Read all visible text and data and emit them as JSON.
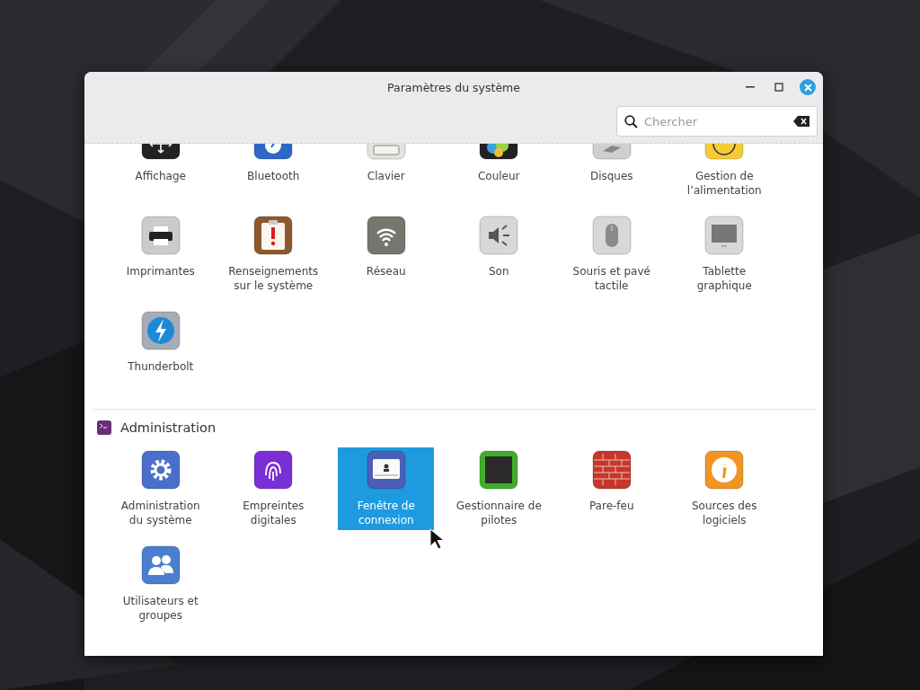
{
  "window": {
    "title": "Paramètres du système"
  },
  "search": {
    "placeholder": "Chercher"
  },
  "sections": [
    {
      "items": [
        {
          "label": "Affichage",
          "kind": "display",
          "selected": false,
          "clipped": true
        },
        {
          "label": "Bluetooth",
          "kind": "bluetooth",
          "selected": false,
          "clipped": true
        },
        {
          "label": "Clavier",
          "kind": "keyboard",
          "selected": false,
          "clipped": true
        },
        {
          "label": "Couleur",
          "kind": "color",
          "selected": false,
          "clipped": true
        },
        {
          "label": "Disques",
          "kind": "disks",
          "selected": false,
          "clipped": true
        },
        {
          "label": "Gestion de l’alimentation",
          "kind": "power",
          "selected": false,
          "clipped": true
        },
        {
          "label": "Imprimantes",
          "kind": "printer",
          "selected": false,
          "clipped": false
        },
        {
          "label": "Renseignements sur le système",
          "kind": "info",
          "selected": false,
          "clipped": false
        },
        {
          "label": "Réseau",
          "kind": "network",
          "selected": false,
          "clipped": false
        },
        {
          "label": "Son",
          "kind": "sound",
          "selected": false,
          "clipped": false
        },
        {
          "label": "Souris et pavé tactile",
          "kind": "mouse",
          "selected": false,
          "clipped": false
        },
        {
          "label": "Tablette graphique",
          "kind": "tablet",
          "selected": false,
          "clipped": false
        },
        {
          "label": "Thunderbolt",
          "kind": "thunderbolt",
          "selected": false,
          "clipped": false
        }
      ]
    },
    {
      "title": "Administration",
      "items": [
        {
          "label": "Administration du système",
          "kind": "gear",
          "selected": false,
          "clipped": false
        },
        {
          "label": "Empreintes digitales",
          "kind": "fingerprint",
          "selected": false,
          "clipped": false
        },
        {
          "label": "Fenêtre de connexion",
          "kind": "login",
          "selected": true,
          "clipped": false
        },
        {
          "label": "Gestionnaire de pilotes",
          "kind": "chip",
          "selected": false,
          "clipped": false
        },
        {
          "label": "Pare-feu",
          "kind": "firewall",
          "selected": false,
          "clipped": false
        },
        {
          "label": "Sources des logiciels",
          "kind": "sources",
          "selected": false,
          "clipped": false
        },
        {
          "label": "Utilisateurs et groupes",
          "kind": "users",
          "selected": false,
          "clipped": false
        }
      ]
    }
  ]
}
